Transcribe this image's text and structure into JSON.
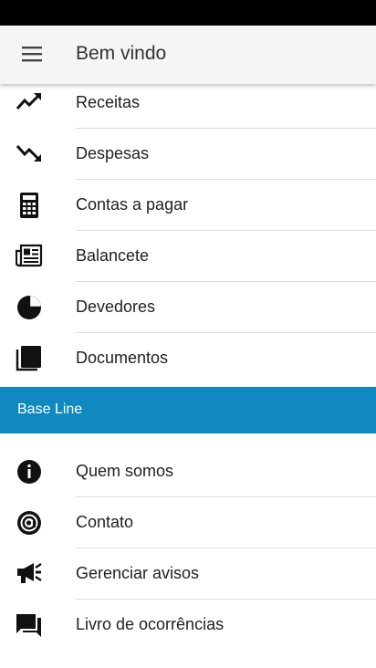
{
  "header": {
    "title": "Bem vindo",
    "menu_icon": "hamburger-menu-icon"
  },
  "menu": {
    "items": [
      {
        "label": "Receitas",
        "icon": "trending-up-icon"
      },
      {
        "label": "Despesas",
        "icon": "trending-down-icon"
      },
      {
        "label": "Contas a pagar",
        "icon": "calculator-icon"
      },
      {
        "label": "Balancete",
        "icon": "newspaper-icon"
      },
      {
        "label": "Devedores",
        "icon": "pie-chart-icon"
      },
      {
        "label": "Documentos",
        "icon": "documents-icon"
      }
    ]
  },
  "section": {
    "title": "Base Line",
    "color": "#0f89c0"
  },
  "secondary": {
    "items": [
      {
        "label": "Quem somos",
        "icon": "info-icon"
      },
      {
        "label": "Contato",
        "icon": "at-sign-icon"
      },
      {
        "label": "Gerenciar avisos",
        "icon": "megaphone-icon"
      },
      {
        "label": "Livro de ocorrências",
        "icon": "forum-icon"
      }
    ]
  }
}
